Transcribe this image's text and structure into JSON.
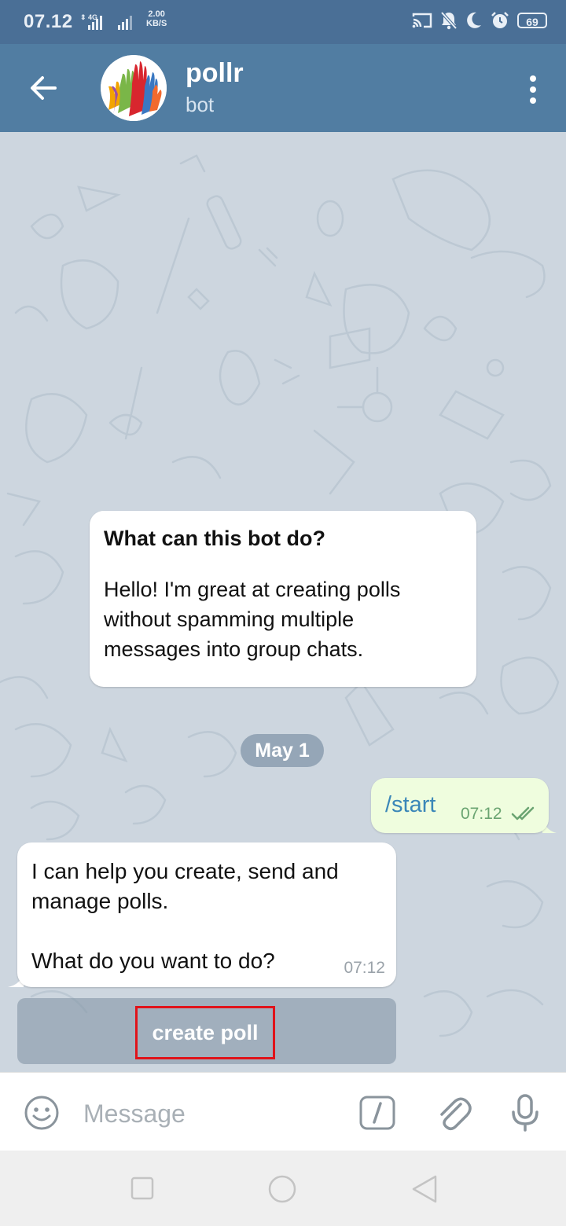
{
  "status_bar": {
    "time": "07.12",
    "network_type": "4G",
    "speed_value": "2.00",
    "speed_unit": "KB/S",
    "battery": "69",
    "icons": [
      "cast-icon",
      "mute-icon",
      "moon-icon",
      "alarm-icon",
      "battery-icon"
    ]
  },
  "header": {
    "title": "pollr",
    "subtitle": "bot",
    "colors": {
      "background": "#517da2",
      "status_bar": "#4a6f96"
    }
  },
  "chat": {
    "bot_info": {
      "title": "What can this bot do?",
      "text": "Hello! I'm great at creating polls\nwithout spamming multiple\nmessages into group chats."
    },
    "date_separator": "May 1",
    "outgoing_message": {
      "text": "/start",
      "time": "07:12"
    },
    "incoming_message": {
      "text": "I can help you create, send and\nmanage polls.\n\nWhat do you want to do?",
      "time": "07:12"
    },
    "keyboard_button": {
      "label": "create poll"
    }
  },
  "input_bar": {
    "placeholder": "Message"
  }
}
